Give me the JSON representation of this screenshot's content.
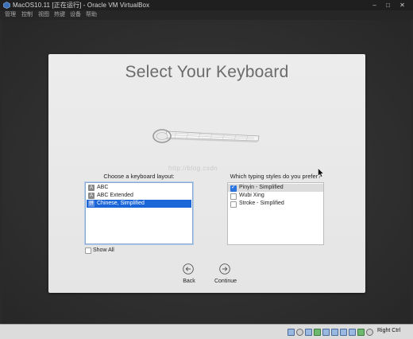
{
  "window": {
    "title": "MacOS10.11 [正在运行] - Oracle VM VirtualBox",
    "controls": {
      "minimize": "–",
      "maximize": "□",
      "close": "✕"
    }
  },
  "menubar": {
    "items": [
      {
        "label": "管理"
      },
      {
        "label": "控制"
      },
      {
        "label": "视图"
      },
      {
        "label": "热键"
      },
      {
        "label": "设备"
      },
      {
        "label": "帮助"
      }
    ]
  },
  "setup": {
    "title": "Select Your Keyboard",
    "watermark": "http://blog.csdn",
    "layout_label": "Choose a keyboard layout:",
    "layouts": [
      {
        "label": "ABC",
        "icon": "A",
        "selected": false
      },
      {
        "label": "ABC Extended",
        "icon": "A",
        "selected": false
      },
      {
        "label": "Chinese, Simplified",
        "icon": "拼",
        "selected": true
      }
    ],
    "styles_label": "Which typing styles do you prefer?",
    "styles": [
      {
        "label": "Pinyin - Simplified",
        "checked": true
      },
      {
        "label": "Wubi Xing",
        "checked": false
      },
      {
        "label": "Stroke - Simplified",
        "checked": false
      }
    ],
    "show_all_label": "Show All",
    "show_all_checked": false,
    "back_label": "Back",
    "continue_label": "Continue"
  },
  "statusbar": {
    "host_key": "Right Ctrl"
  },
  "colors": {
    "selection": "#1a66d9",
    "checkbox_checked": "#2b74e0",
    "panel": "#ececec"
  }
}
